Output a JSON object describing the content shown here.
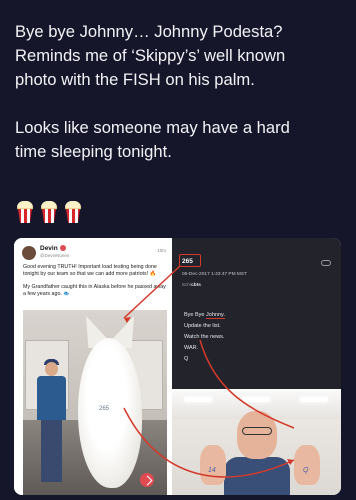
{
  "post": {
    "paragraph1": "Bye bye Johnny… Johnny Podesta?\nReminds me of ‘Skippy’s’ well known\nphoto with the FISH on his palm.",
    "paragraph2": "Looks like someone may have a hard\ntime sleeping tonight.",
    "emoji_count": 3,
    "emoji_icon": "popcorn-icon"
  },
  "truth_post": {
    "name": "Devin",
    "handle": "@DevinNunes",
    "time": "10m",
    "body1": "Good evening TRUTH! Important load testing being done tonight by our team so that we can add more patriots! 🔥",
    "body2": "My Grandfather caught this in Alaska before he passed away a few years ago. 🐟",
    "fish_label": "265"
  },
  "q_post": {
    "number": "265",
    "date": "05-Dec-2017 1:43:47 PM MST",
    "board_prefix": "8ch/",
    "board": "cbts",
    "lines": [
      "Bye Bye",
      "Johnny.",
      "Update the list.",
      "Watch the news.",
      "WAR.",
      "Q"
    ]
  },
  "podesta_photo": {
    "left_hand_label": "14",
    "right_hand_label": "Q"
  },
  "colors": {
    "background": "#16162b",
    "highlight": "#d43a2a",
    "accent": "#e04b52"
  }
}
